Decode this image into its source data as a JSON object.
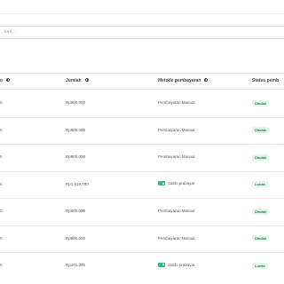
{
  "search": {
    "placeholder": "...kan..."
  },
  "table": {
    "headers": {
      "first": "o",
      "amount": "Jumlah",
      "method": "Metode pembayaran",
      "status": "Status pemb"
    },
    "rows": [
      {
        "first": "5",
        "amount": "Rp800.000",
        "method": "Pembayaran Manual",
        "method_icon": false,
        "status": "Ditolak"
      },
      {
        "first": "5",
        "amount": "Rp800.000",
        "method": "Pembayaran Manual",
        "method_icon": false,
        "status": "Ditolak"
      },
      {
        "first": "5",
        "amount": "Rp800.000",
        "method": "Pembayaran Manual",
        "method_icon": false,
        "status": "Ditolak"
      },
      {
        "first": "5",
        "amount": "Rp1.619.790",
        "method": "Saldo prabayar",
        "method_icon": true,
        "status": "Lunas"
      },
      {
        "first": "5",
        "amount": "Rp800.000",
        "method": "Pembayaran Manual",
        "method_icon": false,
        "status": "Ditolak"
      },
      {
        "first": "5",
        "amount": "Rp800.000",
        "method": "Pembayaran Manual",
        "method_icon": false,
        "status": "Ditolak"
      },
      {
        "first": "5",
        "amount": "Rp401.346",
        "method": "Saldo prabayar",
        "method_icon": true,
        "status": "Lunas"
      }
    ]
  },
  "colors": {
    "badge_text": "#1a8a4d",
    "badge_bg": "#e4f6ea",
    "wallet_icon": "#3cb389"
  }
}
